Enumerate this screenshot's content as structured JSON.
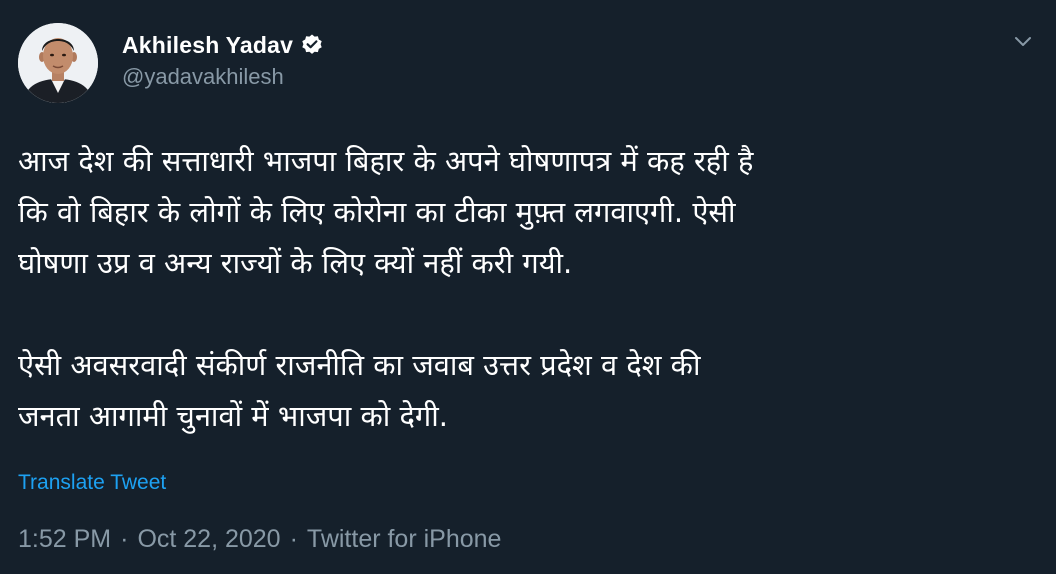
{
  "author": {
    "display_name": "Akhilesh Yadav",
    "handle": "@yadavakhilesh",
    "verified": true,
    "avatar_icon": "profile-photo"
  },
  "tweet": {
    "paragraphs": [
      "आज देश की सत्ताधारी भाजपा बिहार के अपने घोषणापत्र में कह रही है\nकि वो बिहार के लोगों के लिए कोरोना का टीका मुफ़्त लगवाएगी. ऐसी\nघोषणा उप्र व अन्य राज्यों के लिए क्यों नहीं करी गयी.",
      "ऐसी अवसरवादी संकीर्ण राजनीति का जवाब उत्तर प्रदेश व देश की\nजनता आगामी चुनावों में भाजपा को देगी."
    ],
    "translate_label": "Translate Tweet",
    "time": "1:52 PM",
    "date": "Oct 22, 2020",
    "separator": "·",
    "source": "Twitter for iPhone"
  },
  "icons": {
    "verified": "verified-badge-icon",
    "menu": "chevron-down-icon"
  },
  "colors": {
    "background": "#15202b",
    "text": "#ffffff",
    "muted": "#8899a6",
    "link": "#1da1f2"
  }
}
